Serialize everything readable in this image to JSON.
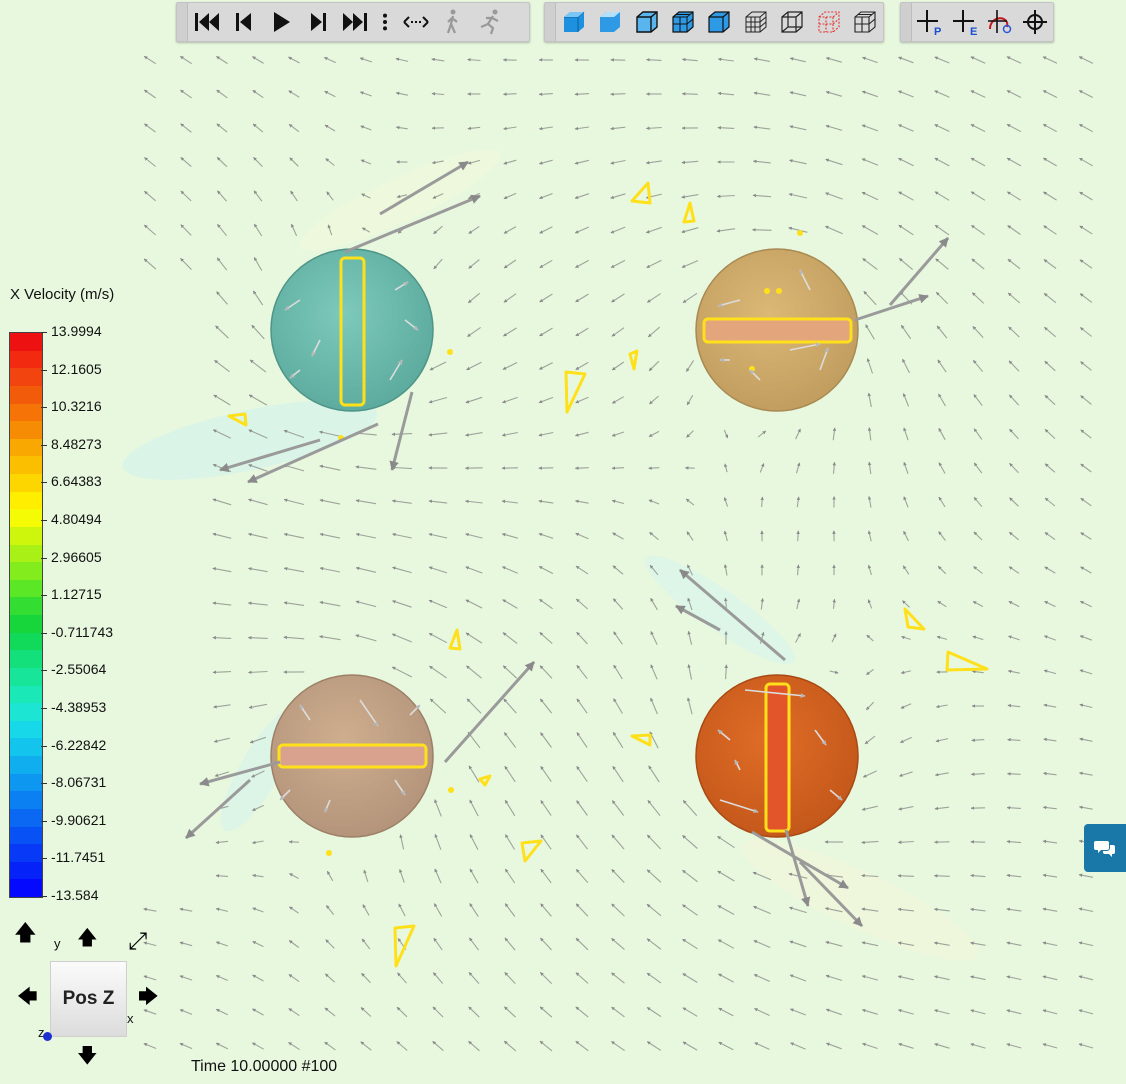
{
  "legend": {
    "title": "X Velocity (m/s)",
    "labels": [
      "13.9994",
      "12.1605",
      "10.3216",
      "8.48273",
      "6.64383",
      "4.80494",
      "2.96605",
      "1.12715",
      "-0.711743",
      "-2.55064",
      "-4.38953",
      "-6.22842",
      "-8.06731",
      "-9.90621",
      "-11.7451",
      "-13.584"
    ],
    "segment_colors": [
      "#ee1111",
      "#f22a10",
      "#f1440e",
      "#f25b0a",
      "#f57307",
      "#f68b04",
      "#f9a701",
      "#fbbf00",
      "#fdd600",
      "#ffee00",
      "#f4fb05",
      "#cef60d",
      "#a8f015",
      "#83ec1c",
      "#5be626",
      "#34dd31",
      "#16d63b",
      "#11d95a",
      "#13e07a",
      "#16e59a",
      "#1ae8b7",
      "#1ce5d3",
      "#17d8e8",
      "#13c4ed",
      "#10aeee",
      "#0e97f1",
      "#0b80f2",
      "#0a68f3",
      "#0851f4",
      "#0739f6",
      "#0522f8",
      "#050aff"
    ]
  },
  "orientation": {
    "face_label": "Pos Z",
    "axes": {
      "x": "x",
      "y": "y",
      "z": "z"
    },
    "icons": [
      "arrow-up-icon",
      "arrow-down-icon",
      "arrow-left-icon",
      "arrow-right-icon",
      "rotate-up-icon",
      "rotate-diagonal-icon"
    ]
  },
  "status": {
    "time_label": "Time 10.00000  #100"
  },
  "toolbars": {
    "playback": [
      "first-frame-icon",
      "step-back-icon",
      "play-icon",
      "step-forward-icon",
      "last-frame-icon",
      "more-options-icon",
      "loop-icon",
      "walk-icon",
      "run-icon"
    ],
    "view": [
      "solid-shaded-icon",
      "smooth-shaded-icon",
      "shaded-edges-icon",
      "mesh-shaded-icon",
      "solid-outline-icon",
      "wireframe-mesh-icon",
      "wireframe-icon",
      "hidden-line-icon",
      "mesh-edges-icon"
    ],
    "probe": [
      "probe-point-icon",
      "probe-element-icon",
      "probe-vector-icon",
      "crosshair-icon"
    ],
    "probe_labels": [
      "P",
      "E"
    ]
  },
  "colors": {
    "background": "#e8f8df",
    "rotor_top_left": "#6fbfb0",
    "rotor_top_right": "#d4ad6d",
    "rotor_bottom_left": "#c4a282",
    "rotor_bottom_right": "#d6631f",
    "outline": "#ffe01a",
    "chat_button": "#1a78a8"
  }
}
